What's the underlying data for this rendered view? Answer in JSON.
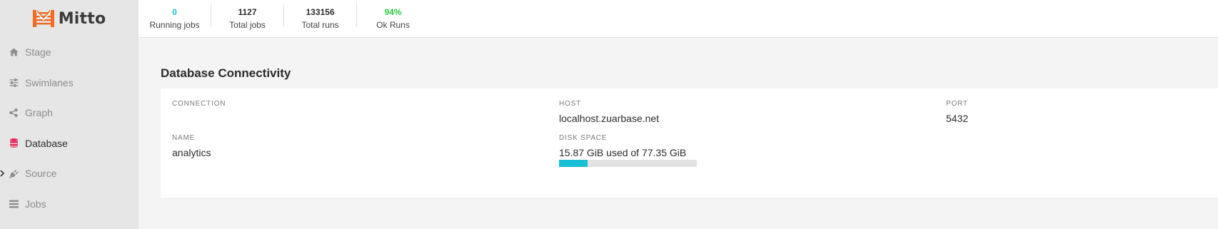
{
  "app": {
    "name": "Mitto"
  },
  "stats": [
    {
      "value": "0",
      "label": "Running jobs",
      "color": "#19bfd4"
    },
    {
      "value": "1127",
      "label": "Total jobs",
      "color": "#2f2f2f"
    },
    {
      "value": "133156",
      "label": "Total runs",
      "color": "#2f2f2f"
    },
    {
      "value": "94%",
      "label": "Ok Runs",
      "color": "#2ecc40"
    }
  ],
  "sidebar": {
    "items": [
      {
        "label": "Stage",
        "icon": "home-icon"
      },
      {
        "label": "Swimlanes",
        "icon": "sliders-icon"
      },
      {
        "label": "Graph",
        "icon": "share-icon"
      },
      {
        "label": "Database",
        "icon": "database-icon",
        "active": true
      },
      {
        "label": "Source",
        "icon": "plug-icon"
      },
      {
        "label": "Jobs",
        "icon": "list-icon"
      }
    ]
  },
  "database": {
    "title": "Database Connectivity",
    "connection_label": "CONNECTION",
    "host_label": "HOST",
    "host_value": "localhost.zuarbase.net",
    "port_label": "PORT",
    "port_value": "5432",
    "name_label": "NAME",
    "name_value": "analytics",
    "disk_label": "DISK SPACE",
    "disk_value": "15.87 GiB used of 77.35 GiB",
    "disk_used_fraction": 0.205
  },
  "colors": {
    "accent": "#19bfd4",
    "success": "#2ecc40",
    "brand": "#f26b21",
    "active_icon": "#e8265a"
  }
}
